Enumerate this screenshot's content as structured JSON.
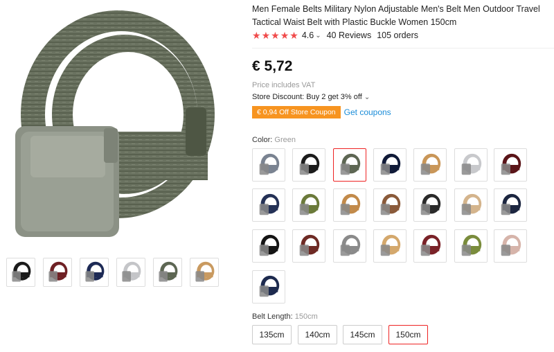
{
  "product": {
    "title": "Men Female Belts Military Nylon Adjustable Men's Belt Men Outdoor Travel Tactical Waist Belt with Plastic Buckle Women 150cm",
    "rating": "4.6",
    "reviews": "40 Reviews",
    "orders": "105 orders",
    "price": "€ 5,72",
    "vat_note": "Price includes VAT",
    "store_discount": "Store Discount: Buy 2 get 3% off",
    "coupon_badge": "€ 0,94 Off Store Coupon",
    "get_coupons": "Get coupons"
  },
  "color": {
    "label": "Color:",
    "selected": "Green",
    "swatches": [
      {
        "color": "#7a8391"
      },
      {
        "color": "#1b1b1b"
      },
      {
        "color": "#5d6653",
        "selected": true
      },
      {
        "color": "#101a38"
      },
      {
        "color": "#c99658"
      },
      {
        "color": "#c8c9cc"
      },
      {
        "color": "#5a1418"
      },
      {
        "color": "#243156"
      },
      {
        "color": "#6b7a3a"
      },
      {
        "color": "#c28a4a"
      },
      {
        "color": "#8a5a3a"
      },
      {
        "color": "#2a2a2a"
      },
      {
        "color": "#d4b48c"
      },
      {
        "color": "#1c2640"
      },
      {
        "color": "#141414"
      },
      {
        "color": "#6e2a24"
      },
      {
        "color": "#8a8a8a"
      },
      {
        "color": "#d4a86c"
      },
      {
        "color": "#7a2228"
      },
      {
        "color": "#7a8c3c"
      },
      {
        "color": "#d6b4aa"
      },
      {
        "color": "#1d2a4e"
      }
    ]
  },
  "gallery": {
    "main_color": "#5d6653",
    "thumbs": [
      {
        "color": "#1b1b1b"
      },
      {
        "color": "#6e2024"
      },
      {
        "color": "#1d2a55"
      },
      {
        "color": "#c4c5c8"
      },
      {
        "color": "#5d6653"
      },
      {
        "color": "#c99a60"
      }
    ]
  },
  "length": {
    "label": "Belt Length:",
    "selected": "150cm",
    "options": [
      "135cm",
      "140cm",
      "145cm",
      "150cm"
    ]
  }
}
